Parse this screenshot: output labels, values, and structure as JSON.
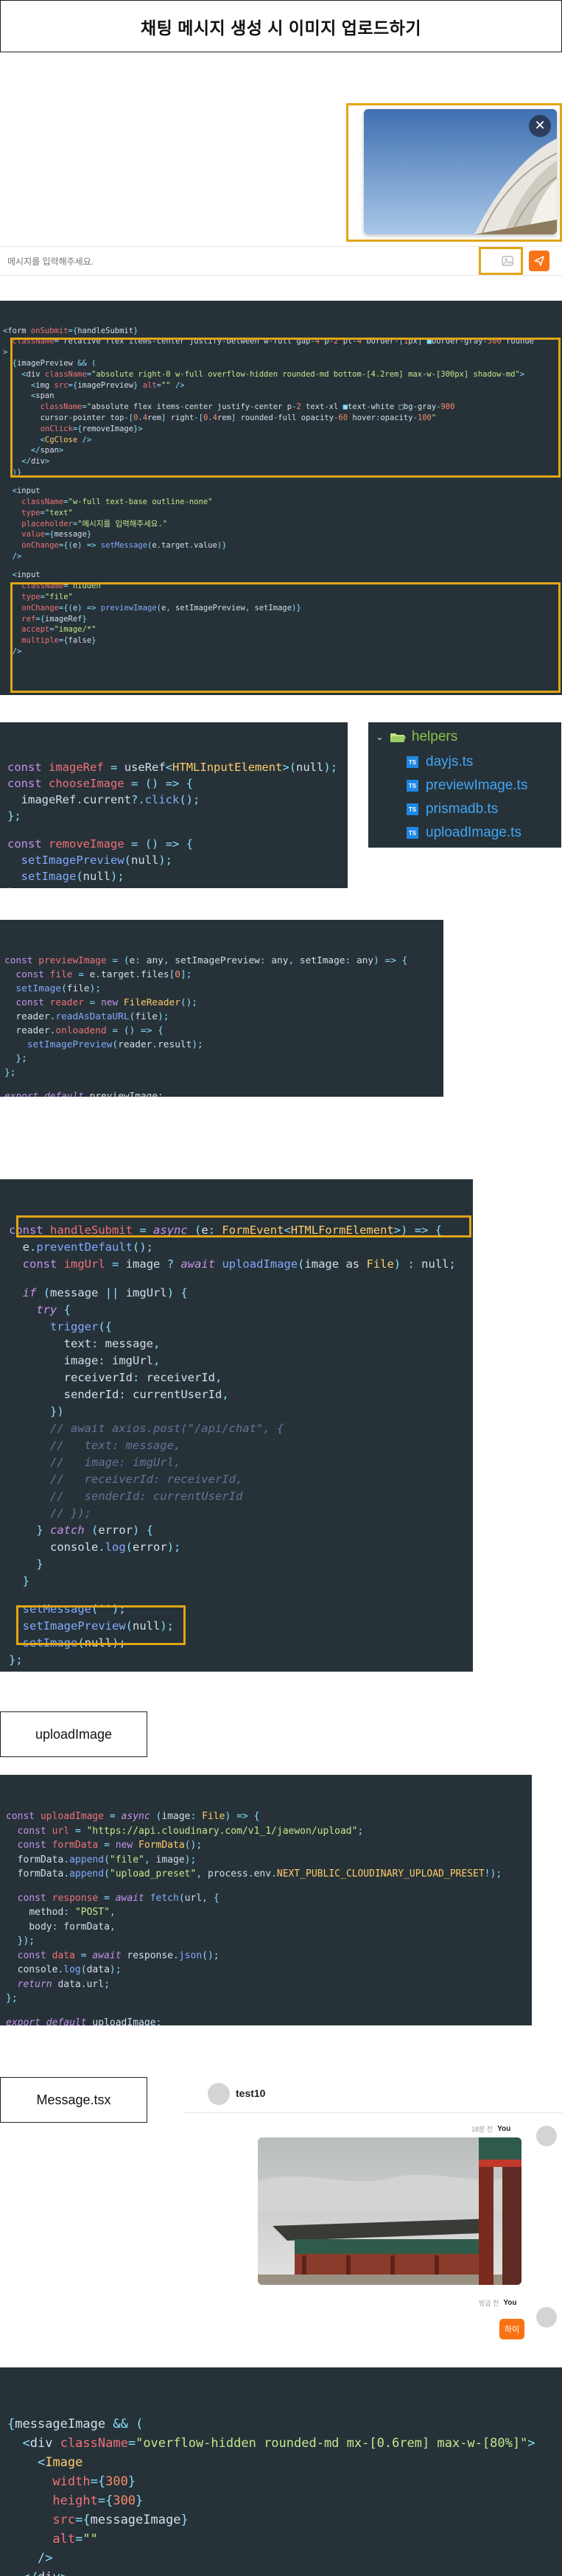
{
  "page": {
    "title": "채팅 메시지 생성 시 이미지 업로드하기"
  },
  "chat_input": {
    "placeholder": "메시지를 입력해주세요.",
    "close_icon": "x-icon",
    "send_icon": "paper-plane-icon",
    "image_icon": "image-icon"
  },
  "code1": [
    "<form onSubmit={handleSubmit}",
    "  className=\"relative flex items-center justify-between w-full gap-4 p-2 pl-4 border-[1px] ■border-gray-300 rounde",
    ">",
    "  {imagePreview && (",
    "    <div className=\"absolute right-0 w-full overflow-hidden rounded-md bottom-[4.2rem] max-w-[300px] shadow-md\">",
    "      <img src={imagePreview} alt=\"\" />",
    "      <span",
    "        className=\"absolute flex items-center justify-center p-2 text-xl ■text-white □bg-gray-900",
    "        cursor-pointer top-[0.4rem] right-[0.4rem] rounded-full opacity-60 hover:opacity-100\"",
    "        onClick={removeImage}>",
    "        <CgClose />",
    "      </span>",
    "    </div>",
    "  )}",
    "",
    "  <input",
    "    className=\"w-full text-base outline-none\"",
    "    type=\"text\"",
    "    placeholder=\"메시지를 입력해주세요.\"",
    "    value={message}",
    "    onChange={(e) => setMessage(e.target.value)}",
    "  />",
    "",
    "  <input",
    "    className=\"hidden\"",
    "    type=\"file\"",
    "    onChange={(e) => previewImage(e, setImagePreview, setImage)}",
    "    ref={imageRef}",
    "    accept=\"image/*\"",
    "    multiple={false}",
    "  />"
  ],
  "code2": [
    "const imageRef = useRef<HTMLInputElement>(null);",
    "const chooseImage = () => {",
    "  imageRef.current?.click();",
    "};",
    "",
    "const removeImage = () => {",
    "  setImagePreview(null);",
    "  setImage(null);",
    "};"
  ],
  "file_tree": {
    "folder": "helpers",
    "files": [
      "dayjs.ts",
      "previewImage.ts",
      "prismadb.ts",
      "uploadImage.ts"
    ],
    "file_icon_text": "TS"
  },
  "code3": [
    "const previewImage = (e: any, setImagePreview: any, setImage: any) => {",
    "  const file = e.target.files[0];",
    "  setImage(file);",
    "  const reader = new FileReader();",
    "  reader.readAsDataURL(file);",
    "  reader.onloadend = () => {",
    "    setImagePreview(reader.result);",
    "  };",
    "};",
    "",
    "export default previewImage;"
  ],
  "code4": [
    "const handleSubmit = async (e: FormEvent<HTMLFormElement>) => {",
    "  e.preventDefault();",
    "  const imgUrl = image ? await uploadImage(image as File) : null;",
    "",
    "  if (message || imgUrl) {",
    "    try {",
    "      trigger({",
    "        text: message,",
    "        image: imgUrl,",
    "        receiverId: receiverId,",
    "        senderId: currentUserId,",
    "      })",
    "      // await axios.post(\"/api/chat\", {",
    "      //   text: message,",
    "      //   image: imgUrl,",
    "      //   receiverId: receiverId,",
    "      //   senderId: currentUserId",
    "      // });",
    "    } catch (error) {",
    "      console.log(error);",
    "    }",
    "  }",
    "",
    "  setMessage('');",
    "  setImagePreview(null);",
    "  setImage(null);",
    "};"
  ],
  "labels": {
    "upload_image": "uploadImage",
    "message_tsx": "Message.tsx"
  },
  "code5": [
    "const uploadImage = async (image: File) => {",
    "  const url = \"https://api.cloudinary.com/v1_1/jaewon/upload\";",
    "  const formData = new FormData();",
    "  formData.append(\"file\", image);",
    "  formData.append(\"upload_preset\", process.env.NEXT_PUBLIC_CLOUDINARY_UPLOAD_PRESET!);",
    "",
    "  const response = await fetch(url, {",
    "    method: \"POST\",",
    "    body: formData,",
    "  });",
    "  const data = await response.json();",
    "  console.log(data);",
    "  return data.url;",
    "};",
    "",
    "export default uploadImage;"
  ],
  "chat_demo": {
    "username": "test10",
    "msg1_time": "18분 전",
    "msg1_sender": "You",
    "msg2_time": "방금 전",
    "msg2_sender": "You",
    "msg2_text": "하이"
  },
  "code6": [
    "{messageImage && (",
    "  <div className=\"overflow-hidden rounded-md mx-[0.6rem] max-w-[80%]\">",
    "    <Image",
    "      width={300}",
    "      height={300}",
    "      src={messageImage}",
    "      alt=\"\"",
    "    />",
    "  </div>",
    ")}"
  ],
  "colors": {
    "code_bg": "#263238",
    "highlight": "#e2a516",
    "send_button": "#f97316"
  }
}
